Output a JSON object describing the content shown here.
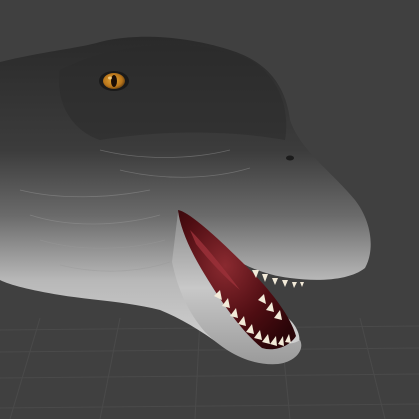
{
  "viewport": {
    "background_color": "#404040",
    "grid_color": "#4a4a4a",
    "shows_grid_floor": true
  },
  "model": {
    "subject": "dinosaur-head",
    "skin_top_color": "#2e2e2e",
    "skin_mid_color": "#5a5a5a",
    "skin_belly_color": "#cfcfcf",
    "eye_color": "#c98a1e",
    "mouth_inner_color": "#5a1015",
    "tongue_color": "#8a2a30",
    "teeth_color": "#f2ead8"
  }
}
